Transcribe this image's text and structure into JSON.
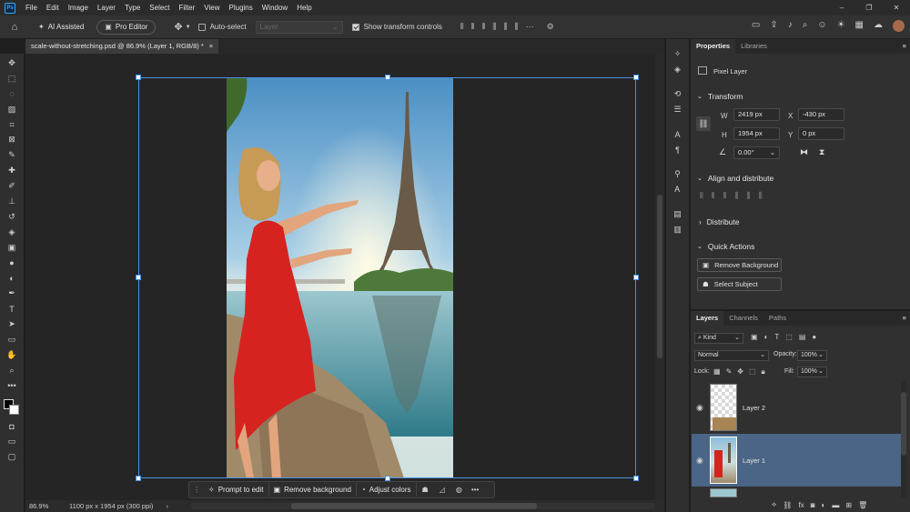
{
  "app": {
    "logo": "Ps"
  },
  "menu": [
    "File",
    "Edit",
    "Image",
    "Layer",
    "Type",
    "Select",
    "Filter",
    "View",
    "Plugins",
    "Window",
    "Help"
  ],
  "window_controls": {
    "minimize": "–",
    "restore": "❐",
    "close": "✕"
  },
  "options": {
    "ai_assisted": "AI Assisted",
    "pro_editor": "Pro Editor",
    "auto_select": "Auto-select",
    "layer_dropdown": "Layer",
    "show_transform": "Show transform controls"
  },
  "document": {
    "tab_title": "scale-without-stretching.psd @ 86.9% (Layer 1, RGB/8) *",
    "close": "×"
  },
  "status": {
    "zoom": "86.9%",
    "info": "1100 px x 1954 px (300 ppi)",
    "arrow": "›"
  },
  "taskbar": {
    "prompt": "Prompt to edit",
    "remove_bg": "Remove background",
    "adjust": "Adjust colors",
    "more": "•••"
  },
  "properties": {
    "tabs": [
      "Properties",
      "Libraries"
    ],
    "layer_type": "Pixel Layer",
    "transform_title": "Transform",
    "w_label": "W",
    "w_value": "2419 px",
    "h_label": "H",
    "h_value": "1954 px",
    "x_label": "X",
    "x_value": "-430 px",
    "y_label": "Y",
    "y_value": "0 px",
    "angle_value": "0.00°",
    "align_title": "Align and distribute",
    "distribute_title": "Distribute",
    "quick_actions_title": "Quick Actions",
    "remove_background": "Remove Background",
    "select_subject": "Select Subject"
  },
  "layers": {
    "tabs": [
      "Layers",
      "Channels",
      "Paths"
    ],
    "kind": "Kind",
    "blend": "Normal",
    "opacity_label": "Opacity:",
    "opacity_value": "100%",
    "lock_label": "Lock:",
    "fill_label": "Fill:",
    "fill_value": "100%",
    "items": [
      {
        "name": "Layer 2",
        "selected": false
      },
      {
        "name": "Layer 1",
        "selected": true
      }
    ]
  },
  "colors": {
    "accent": "#31a8ff",
    "selected_layer": "#4a6585",
    "dress": "#d7231f"
  }
}
